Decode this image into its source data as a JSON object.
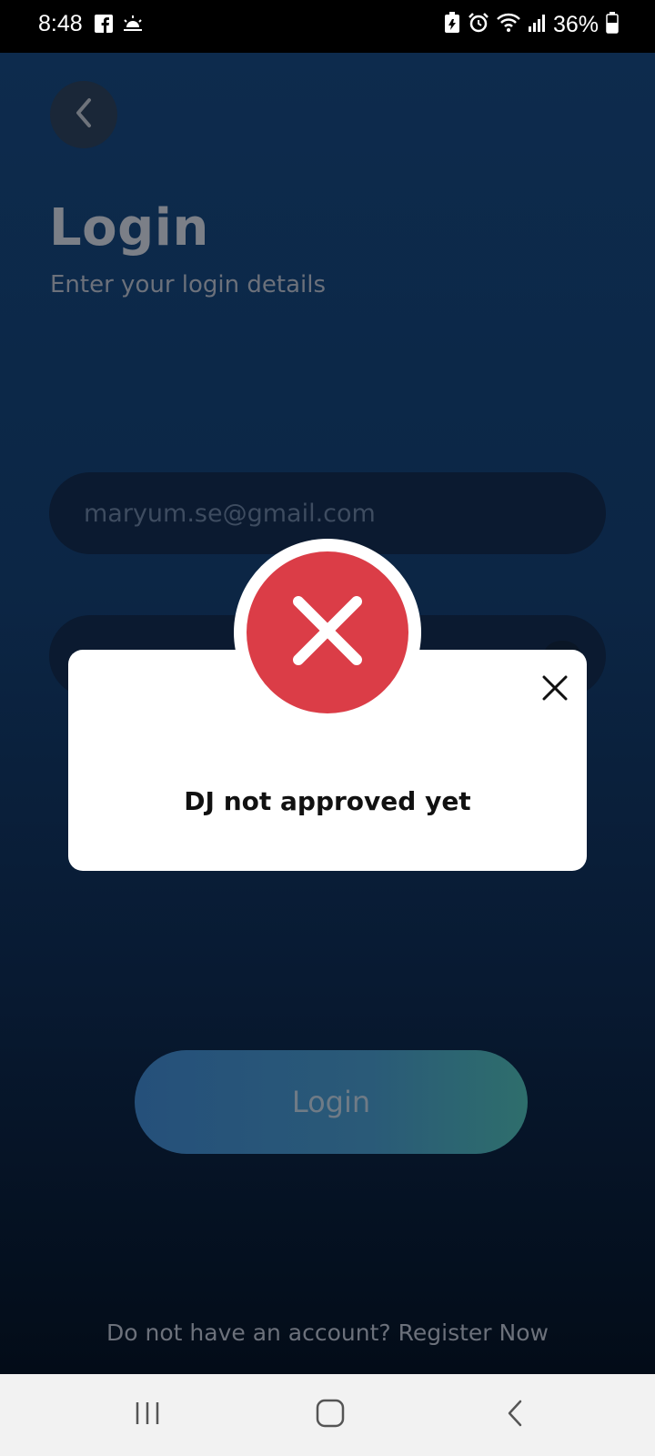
{
  "status_bar": {
    "time": "8:48",
    "battery_percent": "36%",
    "left_icons": [
      "facebook-icon",
      "weather-icon"
    ],
    "right_icons": [
      "battery-saver-icon",
      "alarm-icon",
      "wifi-icon",
      "signal-icon",
      "battery-icon"
    ]
  },
  "header": {
    "title": "Login",
    "subtitle": "Enter your login details"
  },
  "form": {
    "email_placeholder": "maryum.se@gmail.com",
    "login_label": "Login"
  },
  "footer": {
    "register_text": "Do not have an account? Register Now"
  },
  "dialog": {
    "message": "DJ not approved yet",
    "status_color": "#db3d47"
  },
  "navigation": {
    "buttons": [
      "recents-icon",
      "home-icon",
      "back-icon"
    ]
  }
}
